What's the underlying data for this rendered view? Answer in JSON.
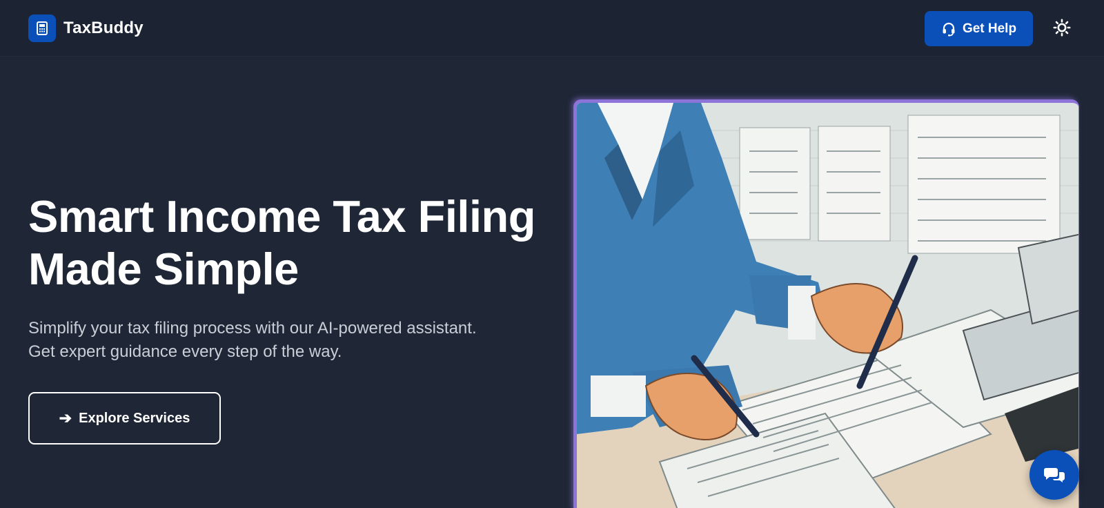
{
  "header": {
    "brand_name": "TaxBuddy",
    "logo_icon": "calculator-icon",
    "help_label": "Get Help",
    "help_icon": "headset-icon",
    "theme_icon": "sun-icon"
  },
  "hero": {
    "title_line1": "Smart Income Tax Filing",
    "title_line2": "Made Simple",
    "subtitle": "Simplify your tax filing process with our AI-powered assistant. Get expert guidance every step of the way.",
    "cta_label": "Explore Services",
    "cta_icon": "arrow-right-icon",
    "image_alt": "illustration-man-filling-tax-forms"
  },
  "chat": {
    "icon": "chat-bubbles-icon"
  },
  "colors": {
    "background": "#1f2736",
    "accent": "#0b4fb8",
    "text": "#ffffff",
    "muted_text": "#c9ced7",
    "image_border": "#8d74d9"
  }
}
